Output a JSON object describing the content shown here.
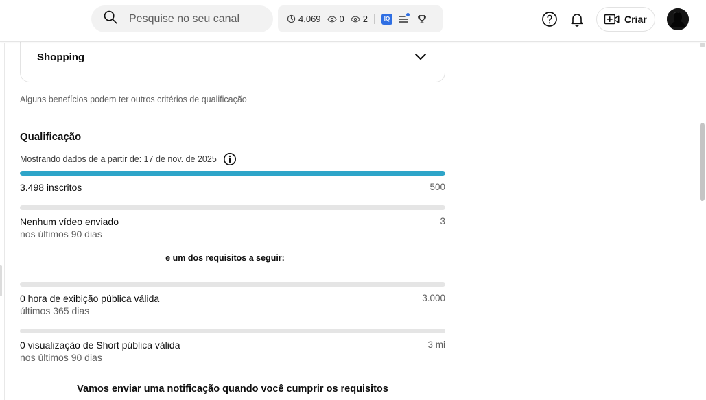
{
  "header": {
    "search": {
      "placeholder": "Pesquise no seu canal",
      "icon": "search-icon"
    },
    "stats": {
      "realtime_views": "4,069",
      "watching": "0",
      "second_views": "2"
    },
    "create_label": "Criar",
    "icons": [
      "help-icon",
      "bell-icon",
      "create-video-icon",
      "avatar"
    ]
  },
  "shopping": {
    "title": "Shopping",
    "note": "Alguns benefícios podem ter outros critérios de qualificação"
  },
  "qualification": {
    "title": "Qualificação",
    "data_since": "Mostrando dados de a partir de: 17 de nov. de 2025",
    "requirements": [
      {
        "label": "3.498 inscritos",
        "sublabel": "",
        "target": "500",
        "progress": 1.0
      },
      {
        "label": "Nenhum vídeo enviado",
        "sublabel": "nos últimos 90 dias",
        "target": "3",
        "progress": 0.0
      }
    ],
    "either_text": "e um dos requisitos a seguir:",
    "alternatives": [
      {
        "label": "0 hora de exibição pública válida",
        "sublabel": "últimos 365 dias",
        "target": "3.000",
        "progress": 0.0
      },
      {
        "label": "0 visualização de Short pública válida",
        "sublabel": "nos últimos 90 dias",
        "target": "3 mi",
        "progress": 0.0
      }
    ],
    "notify_text": "Vamos enviar uma notificação quando você cumprir os requisitos"
  },
  "colors": {
    "progress_fill": "#2ea5c9",
    "progress_track": "#e5e5e5",
    "badge_blue": "#2f6fe3"
  }
}
